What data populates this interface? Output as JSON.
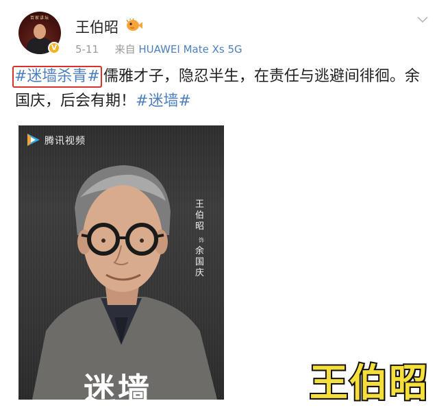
{
  "header": {
    "username": "王伯昭",
    "verified_mark": "V",
    "user_badge_icon": "pufferfish-badge-icon",
    "date": "5-11",
    "source_prefix": "来自",
    "device": "HUAWEI Mate Xs 5G",
    "menu_icon": "chevron-down-icon",
    "avatar_banner": "百家讲坛"
  },
  "post": {
    "topic_1": "#迷墙杀青#",
    "body": "儒雅才子，隐忍半生，在责任与逃避间徘徊。余国庆，后会有期！",
    "topic_2": "#迷墙#"
  },
  "poster": {
    "platform_logo": "tencent-video-logo-icon",
    "platform_name": "腾讯视频",
    "actor_name": "王伯昭",
    "as_label": "饰",
    "role_name": "余国庆",
    "title": "迷墙"
  },
  "watermark": {
    "text": "王伯昭"
  },
  "colors": {
    "link": "#4d7fbf",
    "highlight_box": "#d9302c",
    "watermark_fill": "#f6df3a",
    "verified": "#f4b323"
  }
}
